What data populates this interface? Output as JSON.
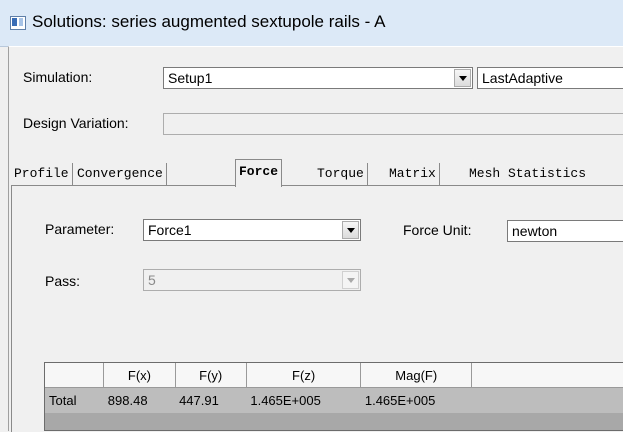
{
  "window": {
    "title": "Solutions: series augmented sextupole rails - A"
  },
  "form": {
    "simulation_label": "Simulation:",
    "simulation_value": "Setup1",
    "adaptive_value": "LastAdaptive",
    "design_variation_label": "Design Variation:",
    "design_variation_value": ""
  },
  "tabs": [
    "Profile",
    "Convergence",
    "Force",
    "Torque",
    "Matrix",
    "Mesh Statistics"
  ],
  "force": {
    "parameter_label": "Parameter:",
    "parameter_value": "Force1",
    "force_unit_label": "Force Unit:",
    "force_unit_value": "newton",
    "pass_label": "Pass:",
    "pass_value": "5"
  },
  "table": {
    "columns": [
      "",
      "F(x)",
      "F(y)",
      "F(z)",
      "Mag(F)"
    ],
    "rows": [
      {
        "label": "Total",
        "fx": "898.48",
        "fy": "447.91",
        "fz": "1.465E+005",
        "mag": "1.465E+005"
      }
    ]
  }
}
